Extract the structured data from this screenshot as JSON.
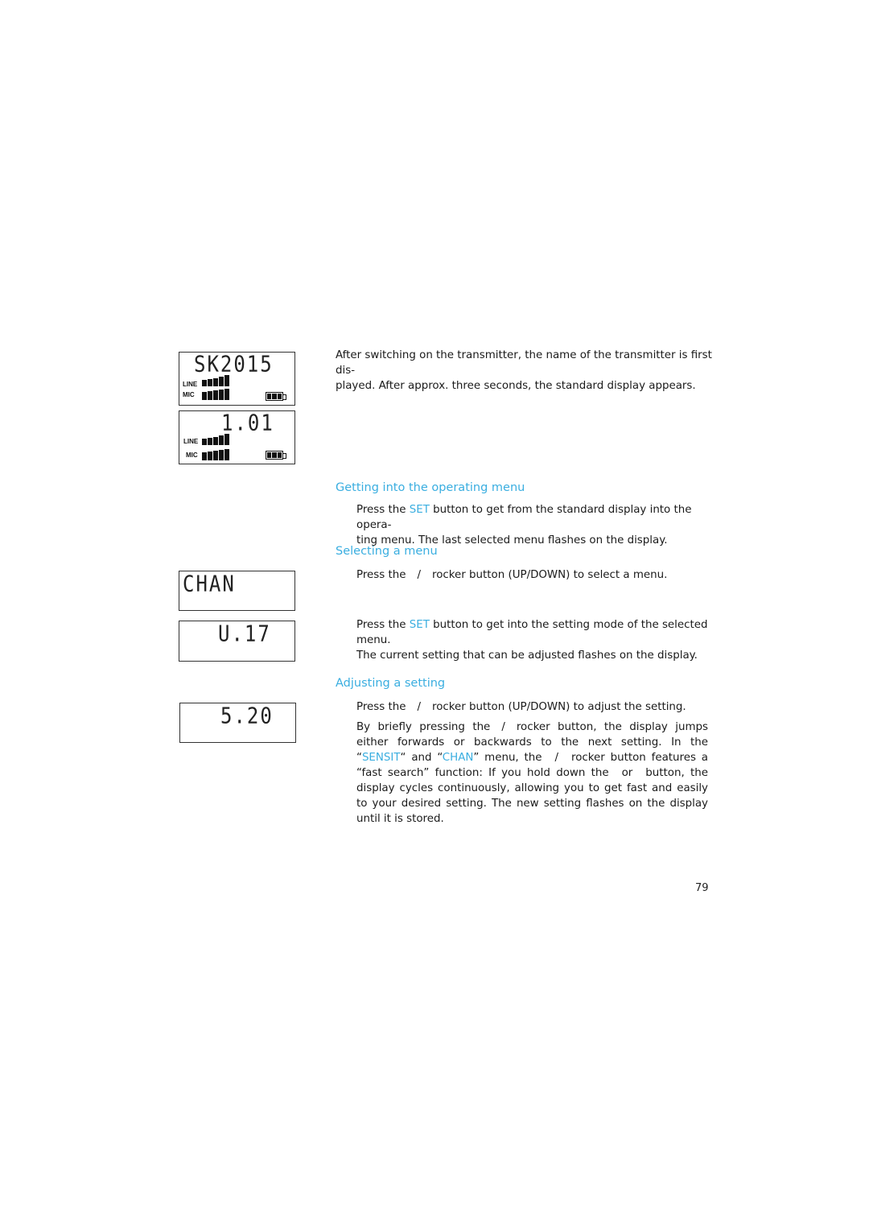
{
  "colors": {
    "accent": "#3aaee0",
    "text": "#1a1a1a"
  },
  "displays": [
    {
      "id": "name",
      "segment_text": "SK2015",
      "show_levels": true,
      "labels": {
        "line": "LINE",
        "mic": "MIC"
      },
      "level_bars": 5,
      "battery_cells": 3
    },
    {
      "id": "standard",
      "segment_text": "1.01",
      "show_levels": true,
      "labels": {
        "line": "LINE",
        "mic": "MIC"
      },
      "level_bars": 5,
      "battery_cells": 3
    },
    {
      "id": "menu",
      "segment_text": "CHAN"
    },
    {
      "id": "setting",
      "segment_text": "U.17"
    },
    {
      "id": "adjust",
      "segment_text": "5.20"
    }
  ],
  "intro": {
    "line1": "After switching on the transmitter, the name of the transmitter is first dis-",
    "line2": "played. After approx. three seconds, the standard display appears."
  },
  "sections": {
    "operating_menu": {
      "heading": "Getting into the operating menu",
      "p1_pre": "Press the ",
      "p1_set": "SET",
      "p1_post": " button to get from the standard display into the opera-",
      "p1_line2": "ting menu. The last selected menu flashes on the display."
    },
    "selecting_menu": {
      "heading": "Selecting a menu",
      "p1_pre": "Press the",
      "p1_slash": "/",
      "p1_post": "rocker button (UP/DOWN) to select a menu.",
      "p2_pre": "Press the ",
      "p2_set": "SET",
      "p2_post": " button to get into the setting mode of the selected menu.",
      "p2_line2": "The current setting that can be adjusted flashes on the display."
    },
    "adjusting": {
      "heading": "Adjusting a setting",
      "p1_pre": "Press the",
      "p1_slash": "/",
      "p1_post": "rocker button (UP/DOWN) to adjust the setting.",
      "p2_a": "By briefly pressing the",
      "p2_slash1": "/",
      "p2_b": "rocker button, the display jumps either forwards or backwards to the next setting. In the “",
      "p2_sensit": "SENSIT",
      "p2_c": "“ and “",
      "p2_chan": "CHAN",
      "p2_d": "” menu, the",
      "p2_slash2": "/",
      "p2_e": "rocker button features a “fast search” function: If you hold down the",
      "p2_or": "or",
      "p2_f": "button, the display cycles continuously, allowing you to get fast and easily to your desired setting. The new setting flashes on the display until it is stored."
    }
  },
  "page_number": "79"
}
